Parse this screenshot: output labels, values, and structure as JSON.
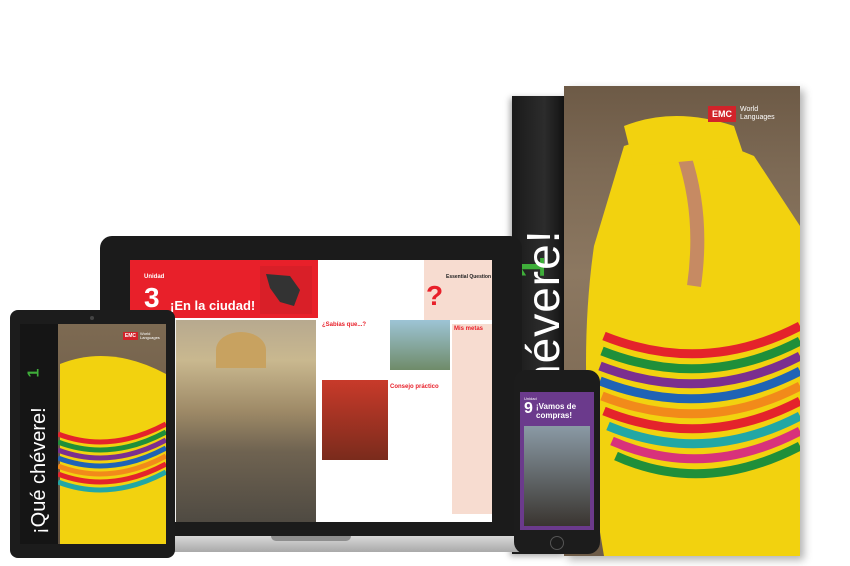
{
  "book": {
    "title": "¡Qué chévere!",
    "number": "1",
    "publisher_logo": "EMC",
    "publisher_text": "World Languages"
  },
  "laptop": {
    "unit_label": "Unidad",
    "unit_number": "3",
    "unit_title": "¡En la ciudad!",
    "essential_question_label": "Essential Question",
    "sabias_que": "¿Sabías que...?",
    "consejo": "Consejo práctico",
    "mis_metas": "Mis metas"
  },
  "tablet": {
    "title": "¡Qué chévere!",
    "number": "1",
    "publisher_logo": "EMC",
    "publisher_text": "World Languages"
  },
  "phone": {
    "unit_label": "Unidad",
    "unit_number": "9",
    "unit_title": "¡Vamos de compras!"
  },
  "colors": {
    "accent_red": "#e8202a",
    "accent_green": "#3fae3a",
    "phone_purple": "#6b3a8c"
  }
}
